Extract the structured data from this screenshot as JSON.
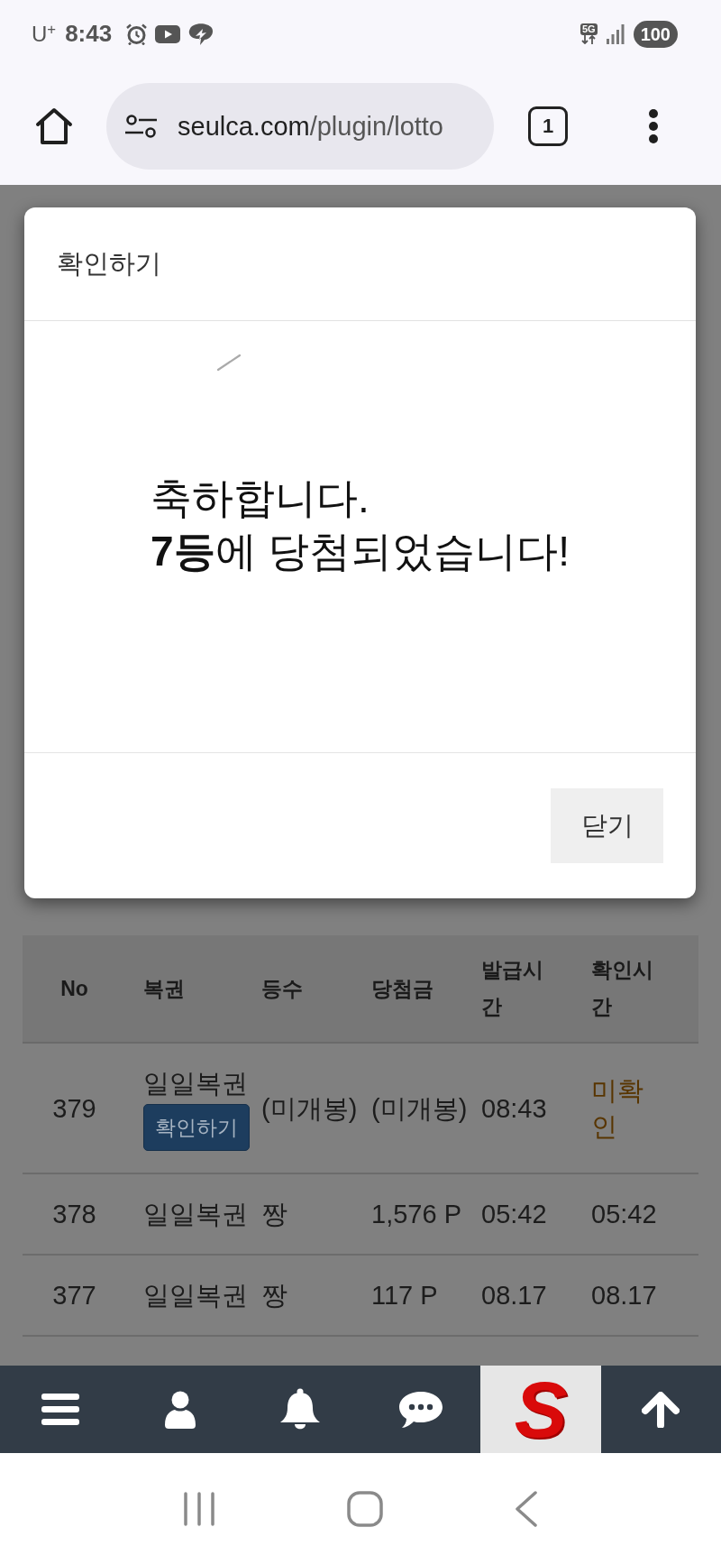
{
  "status_bar": {
    "carrier": "U$^{+}$",
    "time": "8:43",
    "network": "5G",
    "battery": "100"
  },
  "browser": {
    "url_domain": "seulca.com",
    "url_path": "/plugin/lotto",
    "tab_count": "1"
  },
  "modal": {
    "title": "확인하기",
    "message_lines": [
      "축하합니다.",
      "**7등**에 당첨되었습니다!"
    ],
    "close_button": "닫기"
  },
  "table": {
    "columns": [
      "No",
      "복권",
      "등수",
      "당첨금",
      "발급시간",
      "확인시간"
    ],
    "rows": [
      {
        "no": "379",
        "ticket": "일일복권",
        "action": "확인하기",
        "rank": "(미개봉)",
        "prize": "(미개봉)",
        "issued": "08:43",
        "checked_at": "미확인",
        "confirmed": false
      },
      {
        "no": "378",
        "ticket": "일일복권",
        "rank": "짱",
        "prize": "1,576 P",
        "issued": "05:42",
        "checked_at": "05:42",
        "confirmed": true
      },
      {
        "no": "377",
        "ticket": "일일복권",
        "rank": "짱",
        "prize": "117 P",
        "issued": "08.17",
        "checked_at": "08.17",
        "confirmed": true
      }
    ]
  },
  "bottom_nav": {
    "logo_text": "S"
  }
}
